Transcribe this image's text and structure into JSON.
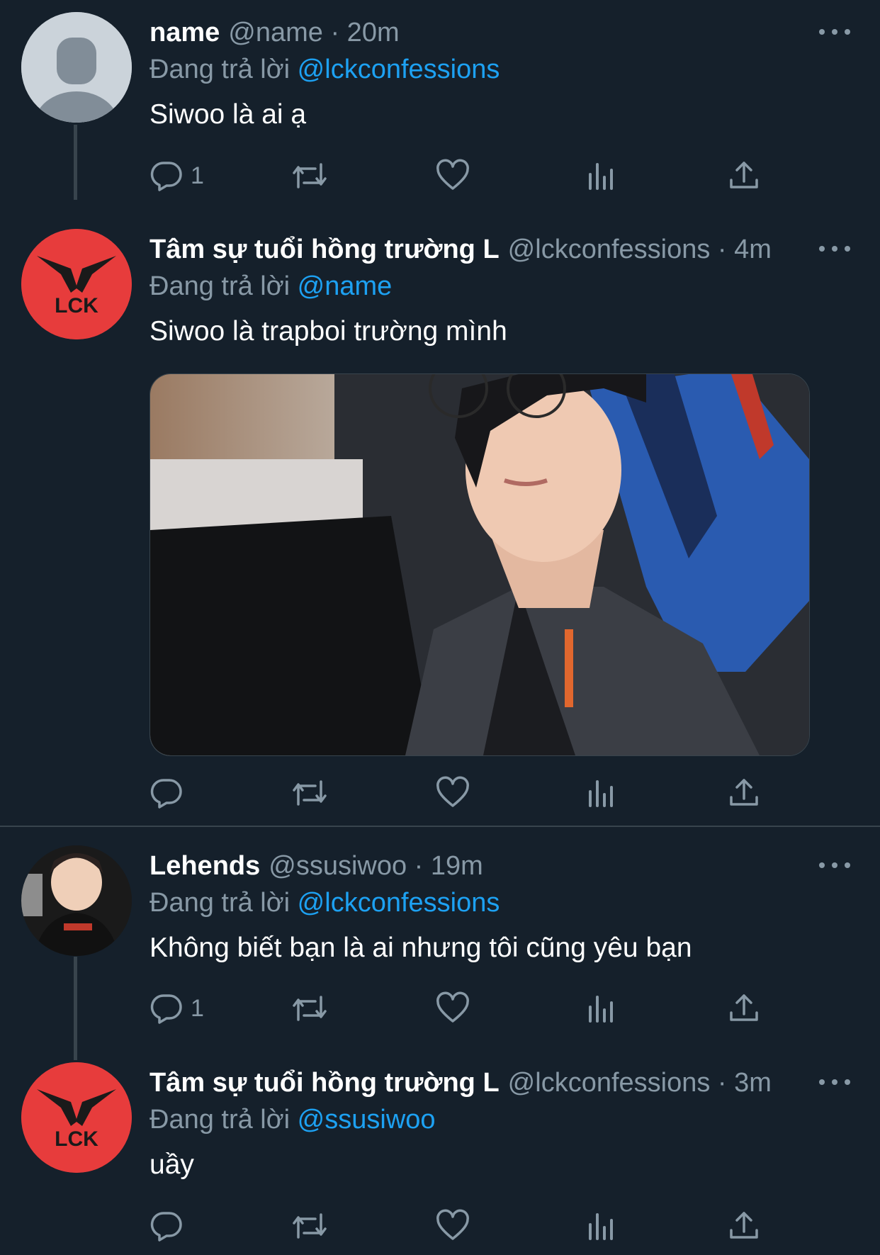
{
  "tweets": [
    {
      "display_name": "name",
      "meta": "@name · 20m",
      "replying_prefix": "Đang trả lời",
      "replying_to": "@lckconfessions",
      "text": "Siwoo là ai ạ",
      "reply_count": "1",
      "avatar": "default-avatar-icon"
    },
    {
      "display_name": "Tâm sự tuổi hồng trường L",
      "meta": "@lckconfessions · 4m",
      "replying_prefix": "Đang trả lời",
      "replying_to": "@name",
      "text": "Siwoo là trapboi trường mình",
      "reply_count": "",
      "avatar": "lck-logo",
      "avatar_text": "LCK",
      "has_media": true
    },
    {
      "display_name": "Lehends",
      "meta": "@ssusiwoo · 19m",
      "replying_prefix": "Đang trả lời",
      "replying_to": "@lckconfessions",
      "text": "Không biết bạn là ai nhưng tôi cũng yêu bạn",
      "reply_count": "1",
      "avatar": "profile-photo"
    },
    {
      "display_name": "Tâm sự tuổi hồng trường L",
      "meta": "@lckconfessions · 3m",
      "replying_prefix": "Đang trả lời",
      "replying_to": "@ssusiwoo",
      "text": "uầy",
      "reply_count": "",
      "avatar": "lck-logo",
      "avatar_text": "LCK"
    }
  ],
  "colors": {
    "background": "#15202b",
    "secondary_text": "#8899a6",
    "link": "#1da1f2",
    "lck_red": "#e73c3c"
  }
}
